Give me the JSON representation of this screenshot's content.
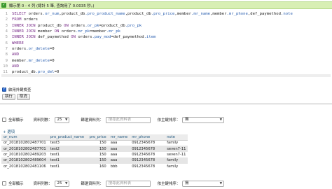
{
  "status": {
    "message": "顯示第 0 - 4 列 (總計 5 筆, 查詢用了 0.0035 秒。)"
  },
  "editor": {
    "lines": [
      {
        "n": "1",
        "parts": [
          [
            "kw",
            "SELECT "
          ],
          [
            "code",
            "orders"
          ],
          [
            "tb",
            ".or_num"
          ],
          [
            "code",
            ",product_db"
          ],
          [
            "tb",
            ".pro_product_name"
          ],
          [
            "code",
            ",product_db"
          ],
          [
            "tb",
            ".pro_price"
          ],
          [
            "code",
            ",member"
          ],
          [
            "tb",
            ".mr_name"
          ],
          [
            "code",
            ",member"
          ],
          [
            "tb",
            ".mr_phone"
          ],
          [
            "code",
            ",def_paymethod"
          ],
          [
            "tb",
            ".note"
          ]
        ]
      },
      {
        "n": "2",
        "parts": [
          [
            "kw",
            "FROM "
          ],
          [
            "code",
            "orders"
          ]
        ]
      },
      {
        "n": "3",
        "parts": [
          [
            "kw",
            "INNER JOIN "
          ],
          [
            "code",
            "product_db "
          ],
          [
            "kw",
            "ON "
          ],
          [
            "code",
            "orders"
          ],
          [
            "tb",
            ".or_pk"
          ],
          [
            "code",
            "=product_db"
          ],
          [
            "tb",
            ".pro_pk"
          ]
        ]
      },
      {
        "n": "4",
        "parts": [
          [
            "kw",
            "INNER JOIN "
          ],
          [
            "code",
            "member "
          ],
          [
            "kw",
            "ON "
          ],
          [
            "code",
            "orders"
          ],
          [
            "tb",
            ".mr_pk"
          ],
          [
            "code",
            "=member"
          ],
          [
            "tb",
            ".mr_pk"
          ]
        ]
      },
      {
        "n": "5",
        "parts": [
          [
            "kw",
            "INNER JOIN "
          ],
          [
            "code",
            "def_paymethod "
          ],
          [
            "kw",
            "ON "
          ],
          [
            "code",
            "orders"
          ],
          [
            "tb",
            ".pay_mod"
          ],
          [
            "code",
            "=def_paymethod"
          ],
          [
            "tb",
            ".item"
          ]
        ]
      },
      {
        "n": "6",
        "parts": [
          [
            "kw",
            "WHERE"
          ]
        ]
      },
      {
        "n": "7",
        "parts": [
          [
            "code",
            "orders"
          ],
          [
            "tb",
            ".or_delete"
          ],
          [
            "code",
            "=0"
          ]
        ]
      },
      {
        "n": "8",
        "parts": [
          [
            "kw",
            "AND"
          ]
        ]
      },
      {
        "n": "9",
        "parts": [
          [
            "code",
            "member"
          ],
          [
            "tb",
            ".mr_delete"
          ],
          [
            "code",
            "=0"
          ]
        ]
      },
      {
        "n": "10",
        "parts": [
          [
            "kw",
            "AND"
          ]
        ]
      },
      {
        "n": "11",
        "parts": [
          [
            "code",
            "product_db"
          ],
          [
            "tb",
            ".pro_del"
          ],
          [
            "code",
            "=0"
          ]
        ]
      }
    ]
  },
  "options": {
    "fk_check_label": "啟用外鍵檢查",
    "fk_check_mark": "✓"
  },
  "buttons": {
    "run": "執行",
    "cancel": "取消"
  },
  "nav": {
    "show_all": "全部顯示",
    "rows_label": "資料列數：",
    "rows_value": "25",
    "filter_label": "篩選資料列：",
    "filter_placeholder": "搜尋此資料表",
    "sort_label": "依主鍵排序：",
    "sort_value": "無",
    "caret": "▼"
  },
  "options_link": "+ 選項",
  "table": {
    "columns": [
      "or_num",
      "pro_product_name",
      "pro_price",
      "mr_name",
      "mr_phone",
      "note"
    ],
    "rows": [
      [
        "or_2018102802487701",
        "test3",
        "150",
        "aaa",
        "0912345678",
        "family"
      ],
      [
        "or_2018102802487701",
        "test2",
        "150",
        "aaa",
        "0912345678",
        "seven7-11"
      ],
      [
        "or_2018102802489203",
        "test1",
        "150",
        "aaa",
        "0912345678",
        "seven7-11"
      ],
      [
        "or_2018102802489604",
        "test1",
        "150",
        "aaa",
        "0912345678",
        "family"
      ],
      [
        "or_2018102802481106",
        "test1",
        "160",
        "bbb",
        "0912345678",
        "family"
      ]
    ]
  }
}
